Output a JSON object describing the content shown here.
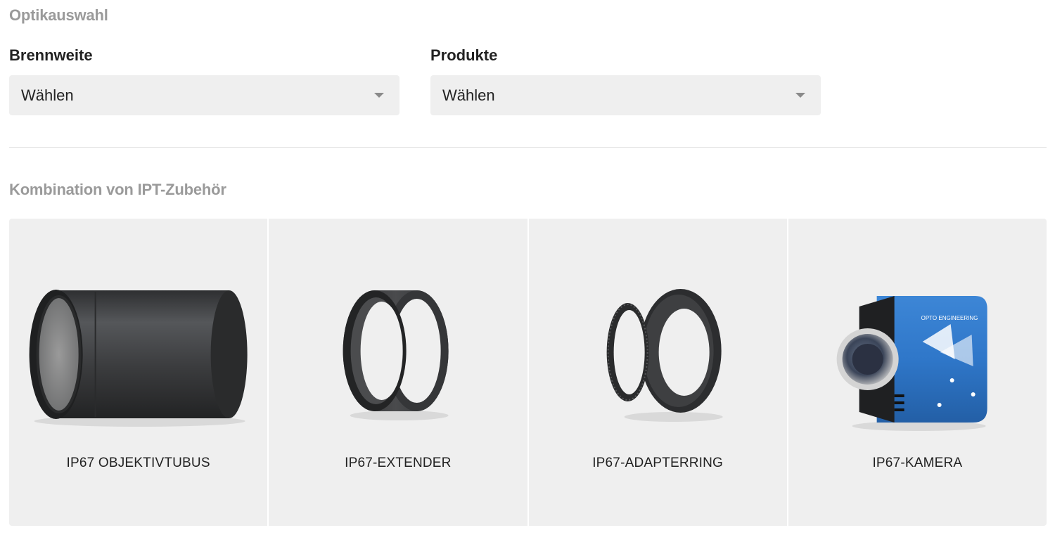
{
  "optics": {
    "title": "Optikauswahl",
    "focal_length": {
      "label": "Brennweite",
      "value": "Wählen"
    },
    "products": {
      "label": "Produkte",
      "value": "Wählen"
    }
  },
  "accessories": {
    "title": "Kombination von IPT-Zubehör",
    "items": [
      {
        "name": "IP67 OBJEKTIVTUBUS",
        "image": "lens-tube"
      },
      {
        "name": "IP67-EXTENDER",
        "image": "extender-ring"
      },
      {
        "name": "IP67-ADAPTERRING",
        "image": "adapter-ring"
      },
      {
        "name": "IP67-KAMERA",
        "image": "camera"
      }
    ]
  },
  "colors": {
    "camera_blue": "#2f77c9",
    "dark_metal": "#3a3b3d"
  }
}
